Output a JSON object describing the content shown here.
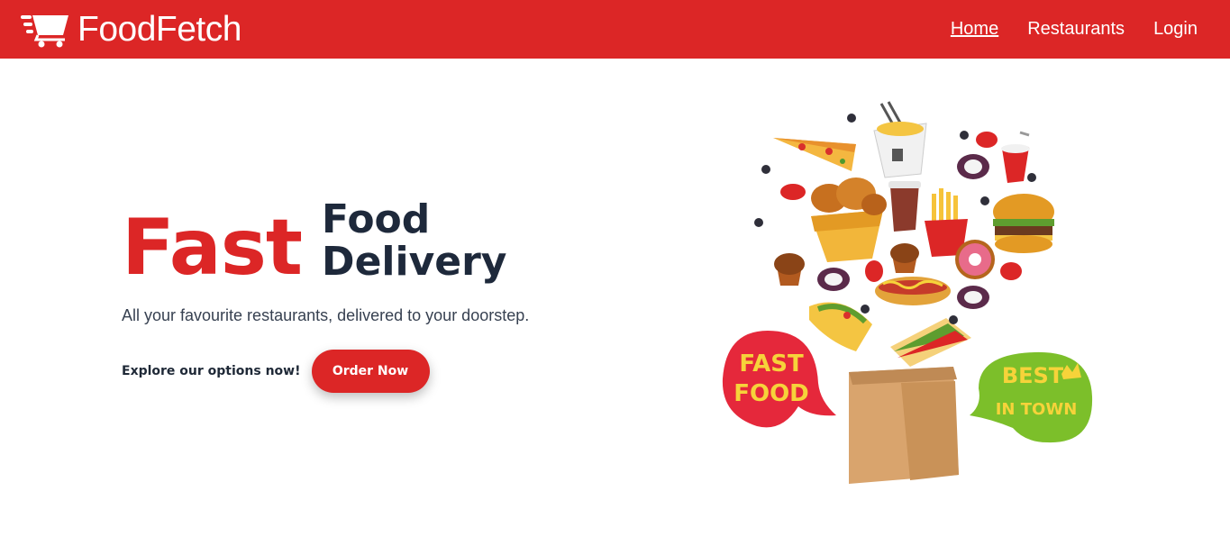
{
  "brand": {
    "name": "FoodFetch",
    "icon": "shopping-cart-icon"
  },
  "nav": {
    "home": "Home",
    "restaurants": "Restaurants",
    "login": "Login"
  },
  "hero": {
    "fast": "Fast",
    "food": "Food",
    "delivery": "Delivery",
    "tagline": "All your favourite restaurants, delivered to your doorstep.",
    "explore": "Explore our options now!",
    "order_button": "Order Now"
  },
  "illustration": {
    "bubble_left_line1": "FAST",
    "bubble_left_line2": "FOOD",
    "bubble_right_line1": "BEST",
    "bubble_right_line2": "IN TOWN"
  },
  "colors": {
    "primary": "#dc2626",
    "heading": "#1e293b",
    "text": "#374151"
  }
}
